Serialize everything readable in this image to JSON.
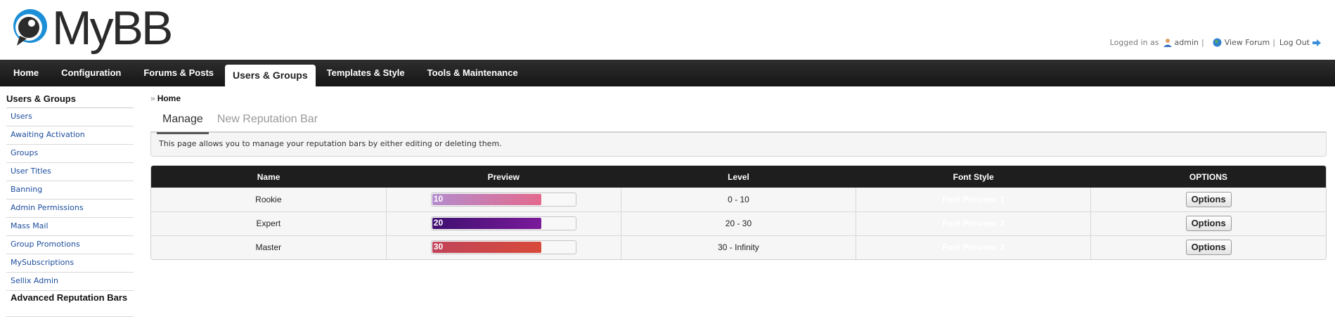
{
  "app": {
    "logo_text": "MyBB"
  },
  "welcome": {
    "logged_in_as": "Logged in as",
    "username": "admin",
    "view_forum": "View Forum",
    "log_out": "Log Out"
  },
  "menu": {
    "items": [
      "Home",
      "Configuration",
      "Forums & Posts",
      "Users & Groups",
      "Templates & Style",
      "Tools & Maintenance"
    ],
    "active": "Users & Groups"
  },
  "sidebar": {
    "title": "Users & Groups",
    "items": [
      "Users",
      "Awaiting Activation",
      "Groups",
      "User Titles",
      "Banning",
      "Admin Permissions",
      "Mass Mail",
      "Group Promotions",
      "MySubscriptions",
      "Sellix Admin",
      "Advanced Reputation Bars"
    ],
    "active": "Advanced Reputation Bars"
  },
  "breadcrumb": {
    "sep": "»",
    "current": "Home"
  },
  "tabs": [
    "Manage",
    "New Reputation Bar"
  ],
  "intro": "This page allows you to manage your reputation bars by either editing or deleting them.",
  "table": {
    "headers": [
      "Name",
      "Preview",
      "Level",
      "Font Style",
      "OPTIONS"
    ],
    "rows": [
      {
        "name": "Rookie",
        "preview_value": "10",
        "level": "0 - 10",
        "font_style": "Font Preview: 1",
        "options": "Options",
        "bar_color_from": "#b48ccc",
        "bar_color_to": "#e36a8e"
      },
      {
        "name": "Expert",
        "preview_value": "20",
        "level": "20 - 30",
        "font_style": "Font Preview: 2",
        "options": "Options",
        "bar_color_from": "#3f1070",
        "bar_color_to": "#7a1a9a"
      },
      {
        "name": "Master",
        "preview_value": "30",
        "level": "30 - Infinity",
        "font_style": "Font Preview: 3",
        "options": "Options",
        "bar_color_from": "#c0445a",
        "bar_color_to": "#d84a3a"
      }
    ]
  },
  "colors": {
    "menu_bg": "#1e1e1e",
    "link": "#1c4d9d",
    "logo_blue": "#1d8fd6"
  }
}
